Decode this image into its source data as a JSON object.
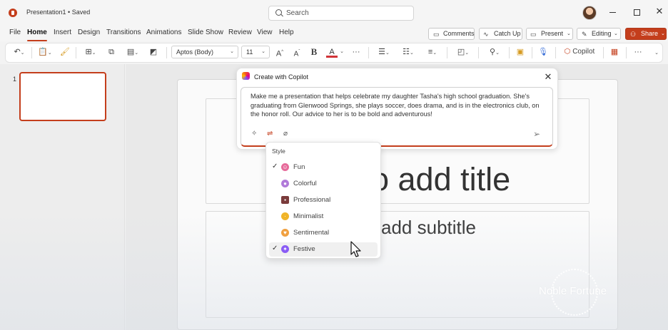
{
  "window": {
    "title": "Presentation1 • Saved",
    "search_placeholder": "Search",
    "close_glyph": "✕"
  },
  "menu": {
    "items": [
      "File",
      "Home",
      "Insert",
      "Design",
      "Transitions",
      "Animations",
      "Slide Show",
      "Review",
      "View",
      "Help"
    ],
    "active": "Home",
    "comments_label": "Comments",
    "catchup_label": "Catch Up",
    "present_label": "Present",
    "editing_label": "Editing",
    "share_label": "Share"
  },
  "ribbon": {
    "font_name": "Aptos (Body)",
    "font_size": "11",
    "grow_font": "A",
    "shrink_font": "A",
    "bold": "B",
    "font_color": "A",
    "font_color_value": "#d13438",
    "more": "···",
    "copilot_label": "Copilot"
  },
  "thumbnails": {
    "slide_number": "1"
  },
  "slide": {
    "title_placeholder": "o add title",
    "subtitle_placeholder": "add subtitle"
  },
  "copilot": {
    "title": "Create with Copilot",
    "prompt": "Make me a presentation that helps celebrate my daughter Tasha's high school graduation. She's graduating from Glenwood Springs, she plays soccer, does drama, and is in the electronics club, on the honor roll. Our advice to her is to be bold and adventurous!"
  },
  "style_menu": {
    "heading": "Style",
    "options": [
      {
        "label": "Fun",
        "checked": true,
        "icon": "smiley-icon",
        "color": "#e66a9a"
      },
      {
        "label": "Colorful",
        "checked": false,
        "icon": "lollipop-icon",
        "color": "#b07ad9"
      },
      {
        "label": "Professional",
        "checked": false,
        "icon": "briefcase-icon",
        "color": "#7a3b3b"
      },
      {
        "label": "Minimalist",
        "checked": false,
        "icon": "neutral-face-icon",
        "color": "#f0b429"
      },
      {
        "label": "Sentimental",
        "checked": false,
        "icon": "sentimental-icon",
        "color": "#f0a040"
      },
      {
        "label": "Festive",
        "checked": true,
        "icon": "party-popper-icon",
        "color": "#8a5cf5"
      }
    ]
  },
  "watermark": {
    "text": "Noble Fortune"
  },
  "colors": {
    "accent": "#c43e1c"
  }
}
